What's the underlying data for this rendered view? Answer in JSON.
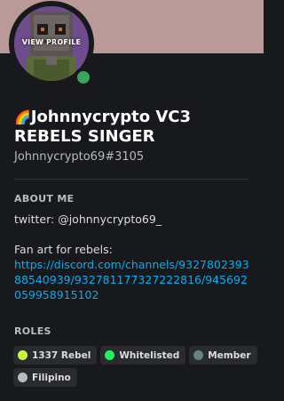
{
  "profile": {
    "banner_color": "#ba9a98",
    "avatar_overlay_label": "VIEW PROFILE",
    "status_color": "#3ba55d",
    "display_name_emoji": "🌈",
    "display_name_line1": "Johnnycrypto VC3",
    "display_name_line2": "REBELS SINGER",
    "tag": "Johnnycrypto69#3105"
  },
  "about": {
    "title": "ABOUT ME",
    "line1": "twitter: @johnnycrypto69_",
    "line2": "Fan art for rebels:",
    "link": "https://discord.com/channels/932780239388540939/932781177327222816/945692059958915102"
  },
  "roles": {
    "title": "ROLES",
    "items": [
      {
        "label": "1337 Rebel",
        "color": "#c8f542"
      },
      {
        "label": "Whitelisted",
        "color": "#25f25e"
      },
      {
        "label": "Member",
        "color": "#6c7f8c"
      },
      {
        "label": "Filipino",
        "color": "#b9bbbe"
      }
    ]
  }
}
